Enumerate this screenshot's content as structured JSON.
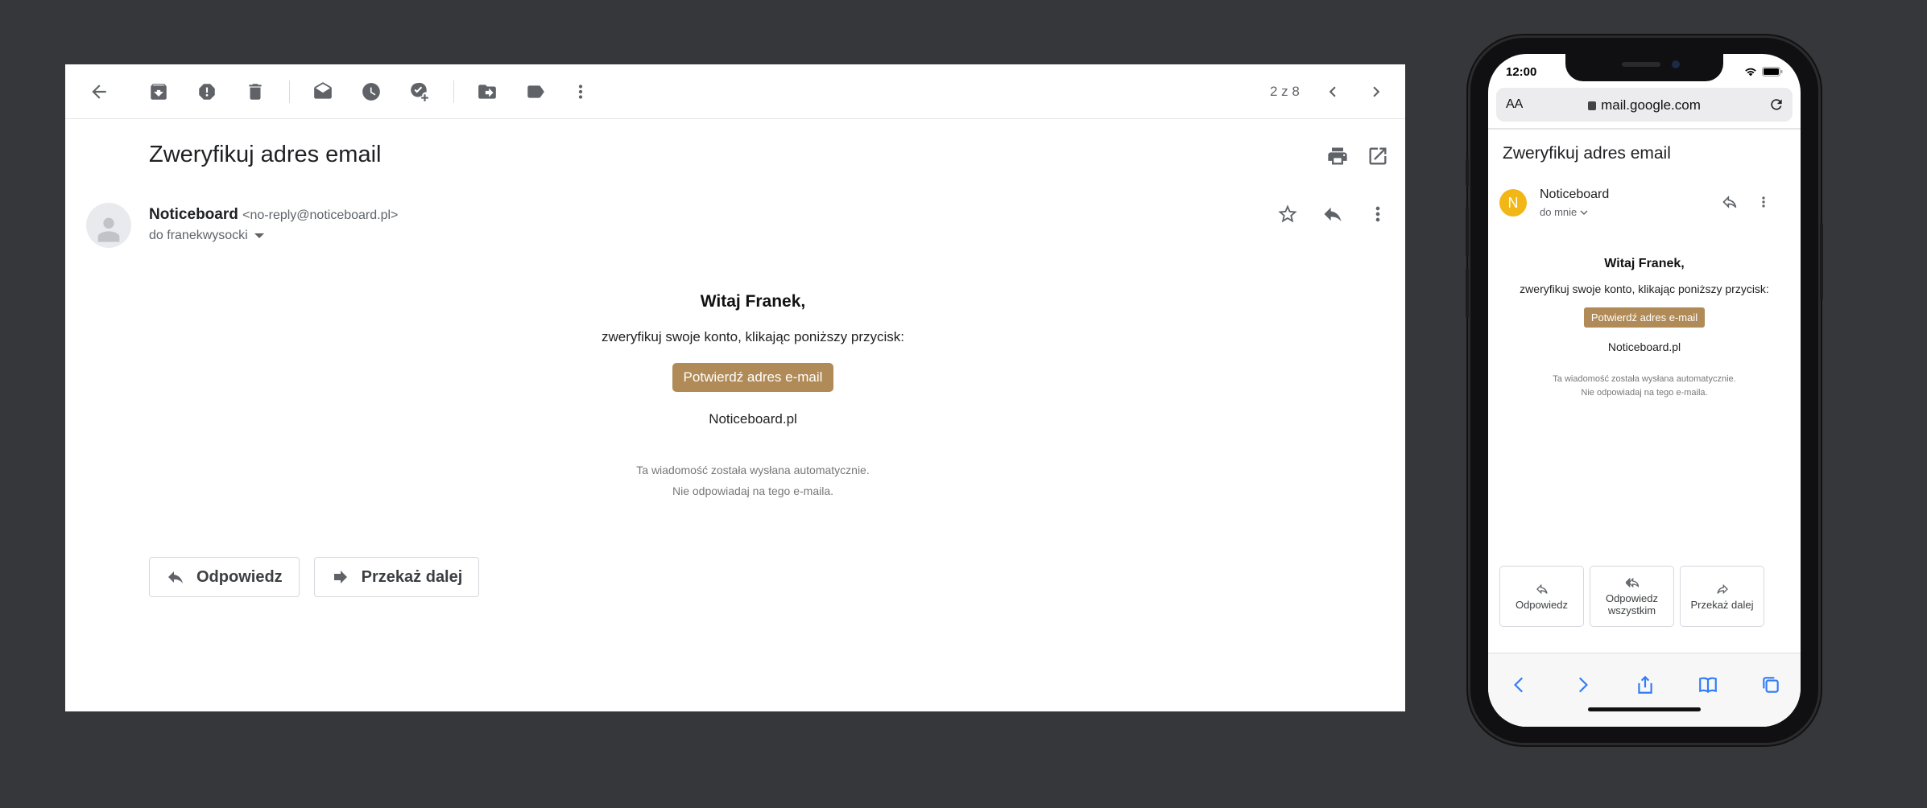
{
  "desktop": {
    "pager": "2 z 8",
    "subject": "Zweryfikuj adres email",
    "sender_name": "Noticeboard",
    "sender_email": "<no-reply@noticeboard.pl>",
    "recipient": "do franekwysocki",
    "body": {
      "greeting": "Witaj Franek,",
      "message": "zweryfikuj swoje konto, klikając poniższy przycisk:",
      "button": "Potwierdź adres e-mail",
      "brand": "Noticeboard.pl",
      "footnote_line1": "Ta wiadomość została wysłana automatycznie.",
      "footnote_line2": "Nie odpowiadaj na tego e-maila."
    },
    "reply_button": "Odpowiedz",
    "forward_button": "Przekaż dalej"
  },
  "mobile": {
    "time": "12:00",
    "text_size": "AA",
    "url": "mail.google.com",
    "subject": "Zweryfikuj adres email",
    "avatar_letter": "N",
    "avatar_color": "#f2b716",
    "sender_name": "Noticeboard",
    "recipient": "do mnie",
    "body": {
      "greeting": "Witaj Franek,",
      "message": "zweryfikuj swoje konto, klikając poniższy przycisk:",
      "button": "Potwierdź adres e-mail",
      "brand": "Noticeboard.pl",
      "footnote_line1": "Ta wiadomość została wysłana automatycznie.",
      "footnote_line2": "Nie odpowiadaj na tego e-maila."
    },
    "actions": {
      "reply": "Odpowiedz",
      "reply_all": "Odpowiedz wszystkim",
      "forward": "Przekaż dalej"
    }
  },
  "colors": {
    "background": "#36373b",
    "cta": "#b08b57",
    "safari_accent": "#2f7cf6"
  }
}
